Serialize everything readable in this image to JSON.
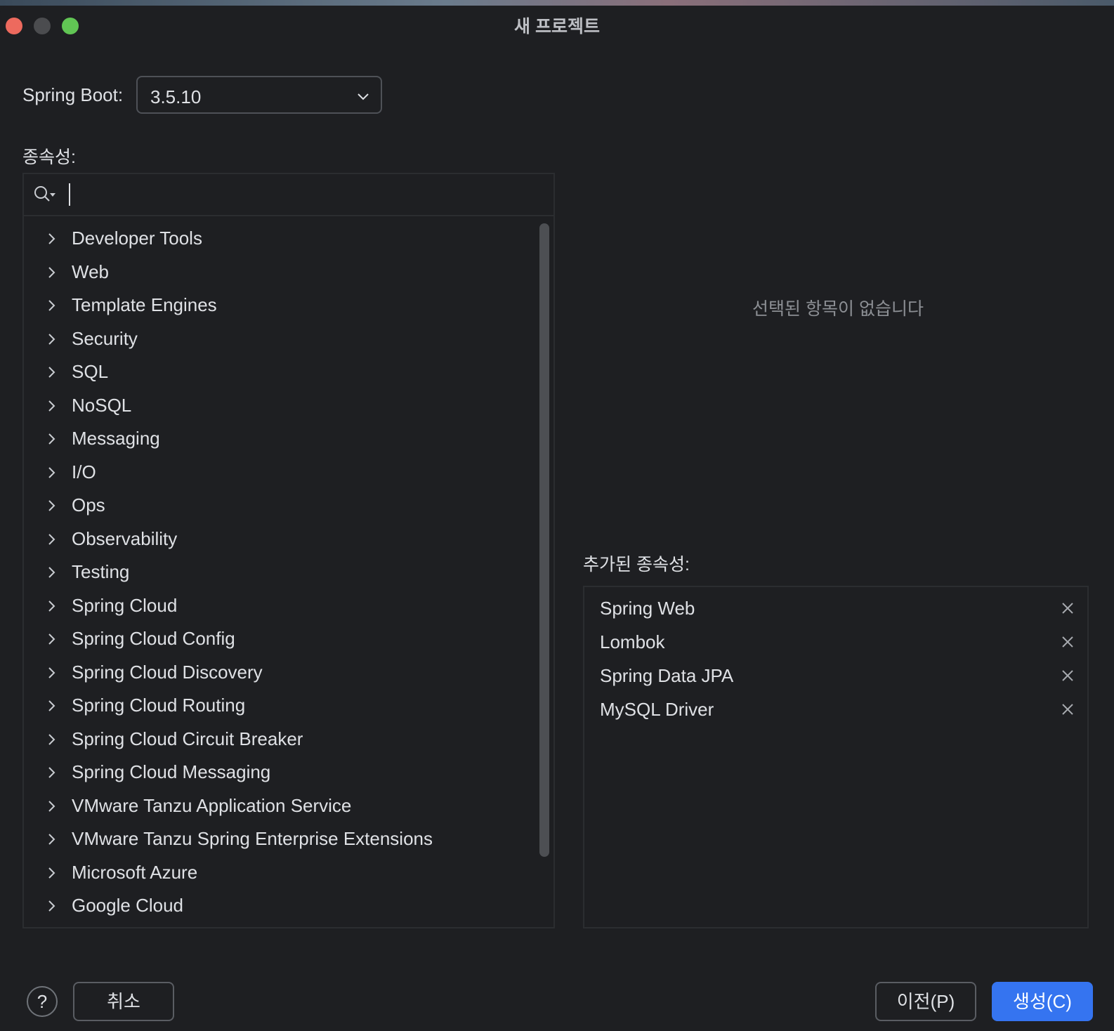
{
  "window": {
    "title": "새 프로젝트"
  },
  "spring_boot": {
    "label": "Spring Boot:",
    "selected_version": "3.5.10"
  },
  "dependencies": {
    "label": "종속성:",
    "search": {
      "value": "",
      "placeholder": ""
    },
    "categories": [
      "Developer Tools",
      "Web",
      "Template Engines",
      "Security",
      "SQL",
      "NoSQL",
      "Messaging",
      "I/O",
      "Ops",
      "Observability",
      "Testing",
      "Spring Cloud",
      "Spring Cloud Config",
      "Spring Cloud Discovery",
      "Spring Cloud Routing",
      "Spring Cloud Circuit Breaker",
      "Spring Cloud Messaging",
      "VMware Tanzu Application Service",
      "VMware Tanzu Spring Enterprise Extensions",
      "Microsoft Azure",
      "Google Cloud"
    ]
  },
  "details": {
    "empty_message": "선택된 항목이 없습니다"
  },
  "added": {
    "label": "추가된 종속성:",
    "items": [
      "Spring Web",
      "Lombok",
      "Spring Data JPA",
      "MySQL Driver"
    ]
  },
  "footer": {
    "help_label": "?",
    "cancel_label": "취소",
    "previous_label": "이전(P)",
    "create_label": "생성(C)"
  },
  "colors": {
    "background": "#1e1f22",
    "accent": "#3574f0",
    "close": "#ed6a5e",
    "maximize": "#61c554"
  },
  "icons": {
    "search": "search-icon",
    "expand": "chevron-right-icon",
    "dropdown": "chevron-down-icon",
    "remove": "close-icon"
  }
}
